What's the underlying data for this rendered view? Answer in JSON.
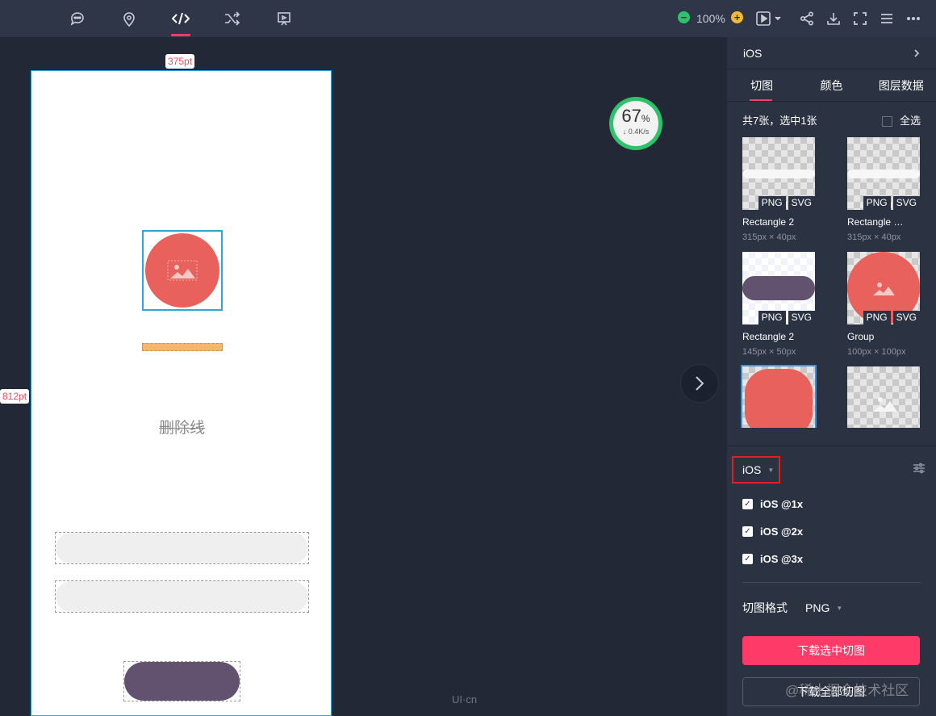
{
  "toolbar": {
    "icons": [
      "comment-icon",
      "location-pin-icon",
      "code-icon",
      "shuffle-icon",
      "present-icon"
    ],
    "zoom": "100%"
  },
  "canvas": {
    "width_tag": "375pt",
    "height_tag": "812pt",
    "strike_text": "删除线",
    "speed_percent": "67",
    "speed_unit": "%",
    "speed_rate": "↓ 0.4K/s",
    "watermark_logo": "UI·cn"
  },
  "panel": {
    "platform_title": "iOS",
    "tabs": [
      "切图",
      "颜色",
      "图层数据"
    ],
    "count_text": "共7张，选中1张",
    "select_all": "全选",
    "format_tags": [
      "PNG",
      "SVG"
    ],
    "slices": [
      {
        "name": "Rectangle 2",
        "size": "315px × 40px"
      },
      {
        "name": "Rectangle …",
        "size": "315px × 40px"
      },
      {
        "name": "Rectangle 2",
        "size": "145px × 50px"
      },
      {
        "name": "Group",
        "size": "100px × 100px"
      },
      {
        "name": "",
        "size": ""
      },
      {
        "name": "",
        "size": ""
      }
    ],
    "platform_select": "iOS",
    "scales": [
      "iOS @1x",
      "iOS @2x",
      "iOS @3x"
    ],
    "format_label": "切图格式",
    "format_value": "PNG",
    "download_selected": "下载选中切图",
    "download_all": "下载全部切图"
  },
  "watermark": "@稀土掘金技术社区",
  "colors": {
    "accent": "#fe3b68",
    "selection": "#2ca6e0",
    "red_circle": "#e8615c",
    "purple_button": "#62516f",
    "orange_bar": "#f3b86f"
  }
}
